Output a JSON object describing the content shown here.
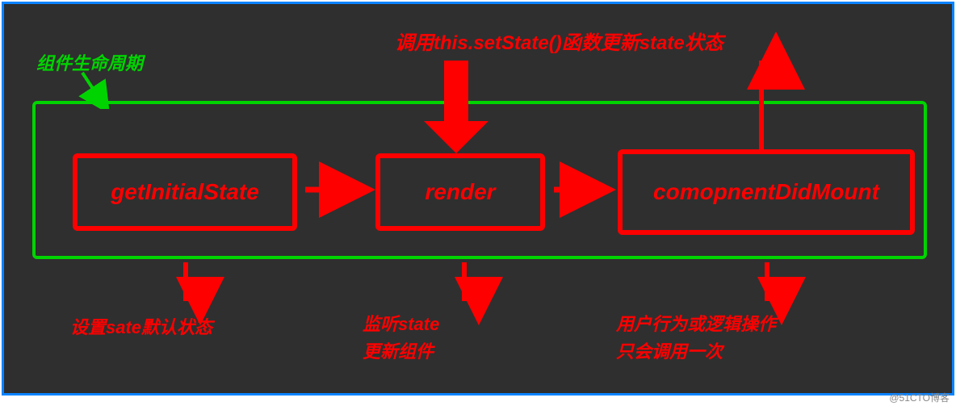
{
  "diagram": {
    "title": "组件生命周期",
    "top_label": "调用this.setState()函数更新state状态",
    "boxes": {
      "getInitialState": "getInitialState",
      "render": "render",
      "componentDidMount": "comopnentDidMount"
    },
    "descriptions": {
      "getInitialState": "设置sate默认状态",
      "render": "监听state\n更新组件",
      "componentDidMount": "用户行为或逻辑操作\n只会调用一次"
    }
  },
  "watermark": "@51CTO博客",
  "chart_data": {
    "type": "flowchart",
    "nodes": [
      {
        "id": "getInitialState",
        "label": "getInitialState",
        "note": "设置sate默认状态"
      },
      {
        "id": "render",
        "label": "render",
        "note": "监听state 更新组件"
      },
      {
        "id": "componentDidMount",
        "label": "comopnentDidMount",
        "note": "用户行为或逻辑操作 只会调用一次"
      }
    ],
    "edges": [
      {
        "from": "getInitialState",
        "to": "render"
      },
      {
        "from": "render",
        "to": "componentDidMount"
      },
      {
        "from": "componentDidMount",
        "to": "setState_label",
        "label": "调用this.setState()函数更新state状态"
      },
      {
        "from": "setState_label",
        "to": "render"
      }
    ],
    "container": "组件生命周期"
  }
}
